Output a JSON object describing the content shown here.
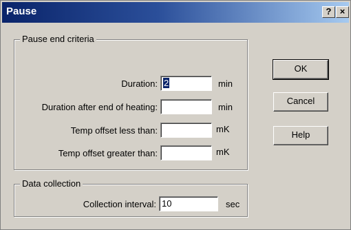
{
  "window": {
    "title": "Pause",
    "help_glyph": "?",
    "close_glyph": "×"
  },
  "criteria": {
    "group_label": "Pause end criteria",
    "duration": {
      "label": "Duration:",
      "value": "2",
      "unit": "min"
    },
    "duration_heating": {
      "label": "Duration after end of heating:",
      "value": "",
      "unit": "min"
    },
    "temp_less": {
      "label": "Temp offset less than:",
      "value": "",
      "unit": "mK"
    },
    "temp_greater": {
      "label": "Temp offset greater than:",
      "value": "",
      "unit": "mK"
    }
  },
  "collection": {
    "group_label": "Data collection",
    "interval": {
      "label": "Collection interval:",
      "value": "10",
      "unit": "sec"
    }
  },
  "buttons": {
    "ok": "OK",
    "cancel": "Cancel",
    "help": "Help"
  }
}
